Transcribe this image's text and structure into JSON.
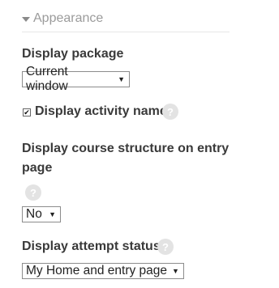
{
  "section": {
    "title": "Appearance"
  },
  "display_package": {
    "label": "Display package",
    "selected": "Current window"
  },
  "display_activity_name": {
    "label": "Display activity name",
    "checked": true
  },
  "display_course_structure": {
    "label_line1": "Display course structure on entry",
    "label_line2": "page",
    "selected": "No"
  },
  "display_attempt_status": {
    "label": "Display attempt status",
    "selected": "My Home and entry page"
  },
  "icons": {
    "collapse": "caret-down-icon",
    "help": "question-mark-icon",
    "dropdown": "chevron-down-icon"
  }
}
